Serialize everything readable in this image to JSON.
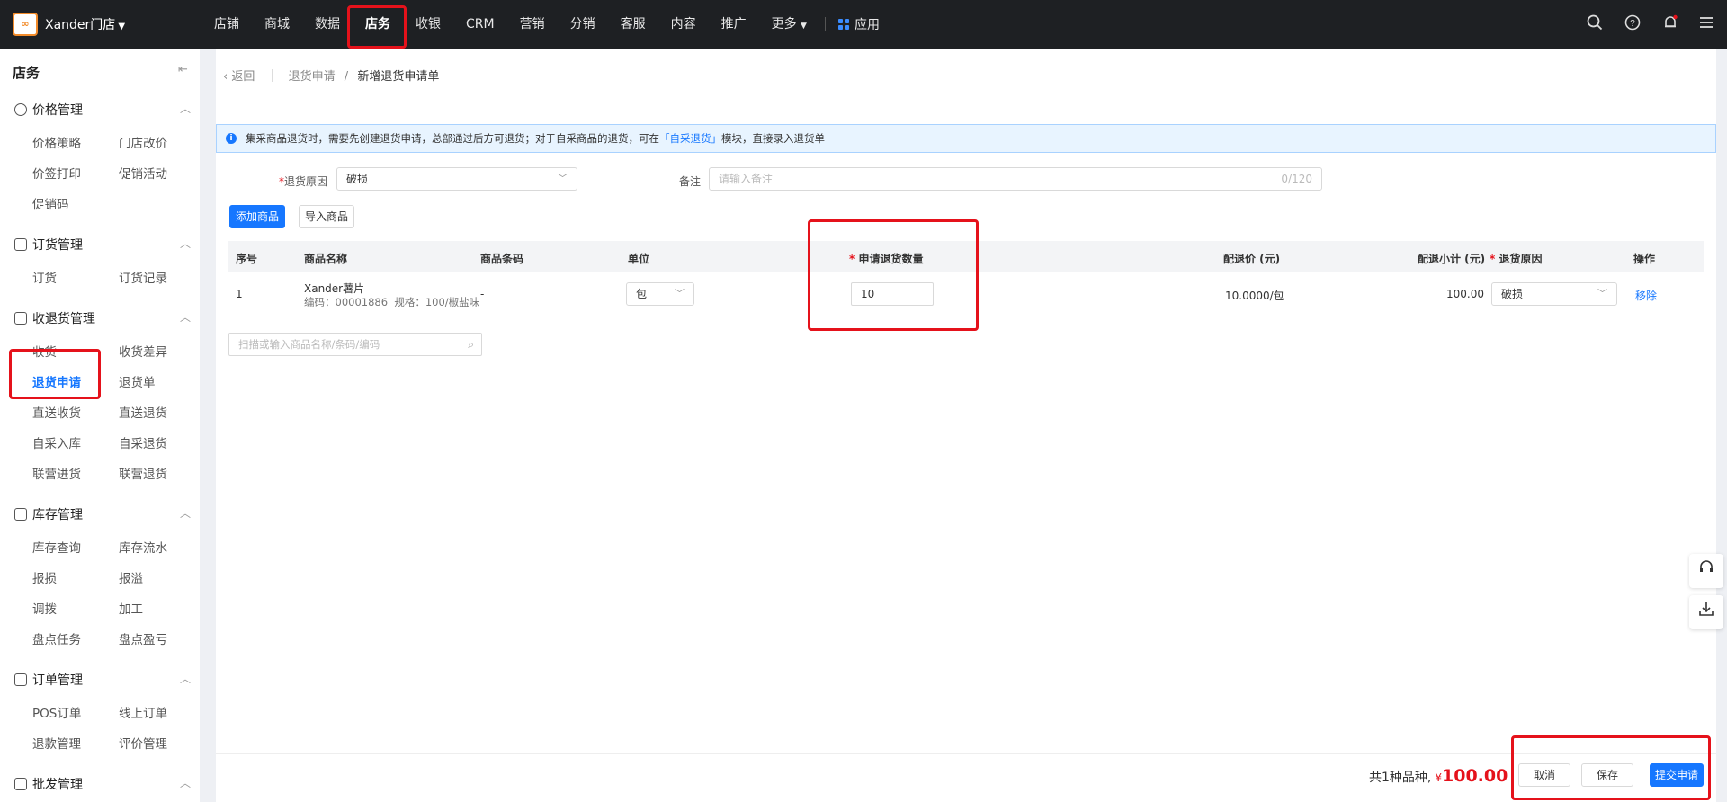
{
  "header": {
    "store_name": "Xander门店",
    "logo_text": "∞",
    "nav": [
      "店铺",
      "商城",
      "数据",
      "店务",
      "收银",
      "CRM",
      "营销",
      "分销",
      "客服",
      "内容",
      "推广",
      "更多"
    ],
    "active_nav": "店务",
    "app_label": "应用"
  },
  "sidebar": {
    "title": "店务",
    "groups": [
      {
        "title": "价格管理",
        "items": [
          "价格策略",
          "门店改价",
          "价签打印",
          "促销活动",
          "促销码"
        ]
      },
      {
        "title": "订货管理",
        "items": [
          "订货",
          "订货记录"
        ]
      },
      {
        "title": "收退货管理",
        "items": [
          "收货",
          "收货差异",
          "退货申请",
          "退货单",
          "直送收货",
          "直送退货",
          "自采入库",
          "自采退货",
          "联营进货",
          "联营退货"
        ]
      },
      {
        "title": "库存管理",
        "items": [
          "库存查询",
          "库存流水",
          "报损",
          "报溢",
          "调拨",
          "加工",
          "盘点任务",
          "盘点盈亏"
        ]
      },
      {
        "title": "订单管理",
        "items": [
          "POS订单",
          "线上订单",
          "退款管理",
          "评价管理"
        ]
      },
      {
        "title": "批发管理",
        "items": []
      }
    ],
    "active_item": "退货申请"
  },
  "breadcrumb": {
    "back": "返回",
    "parent": "退货申请",
    "sep": "/",
    "current": "新增退货申请单"
  },
  "notice": {
    "text_before": "集采商品退货时，需要先创建退货申请，总部通过后方可退货；对于自采商品的退货，可在",
    "link": "「自采退货」",
    "text_after": "模块，直接录入退货单"
  },
  "form": {
    "reason_label": "退货原因",
    "reason_value": "破损",
    "remark_label": "备注",
    "remark_placeholder": "请输入备注",
    "remark_count": "0/120"
  },
  "buttons": {
    "add_product": "添加商品",
    "import_product": "导入商品",
    "cancel": "取消",
    "save": "保存",
    "submit": "提交申请"
  },
  "table": {
    "headers": {
      "seq": "序号",
      "name": "商品名称",
      "barcode": "商品条码",
      "unit": "单位",
      "qty": "申请退货数量",
      "price": "配退价 (元)",
      "subtotal": "配退小计 (元)",
      "reason": "退货原因",
      "action": "操作"
    },
    "rows": [
      {
        "seq": "1",
        "name": "Xander薯片",
        "code": "编码：00001886",
        "spec": "规格：100/椒盐味",
        "barcode": "-",
        "unit": "包",
        "qty": "10",
        "price": "10.0000/包",
        "subtotal": "100.00",
        "reason": "破损",
        "action": "移除"
      }
    ]
  },
  "search": {
    "placeholder": "扫描或输入商品名称/条码/编码"
  },
  "summary": {
    "text": "共1种品种,",
    "currency": "¥",
    "amount": "100.00"
  }
}
